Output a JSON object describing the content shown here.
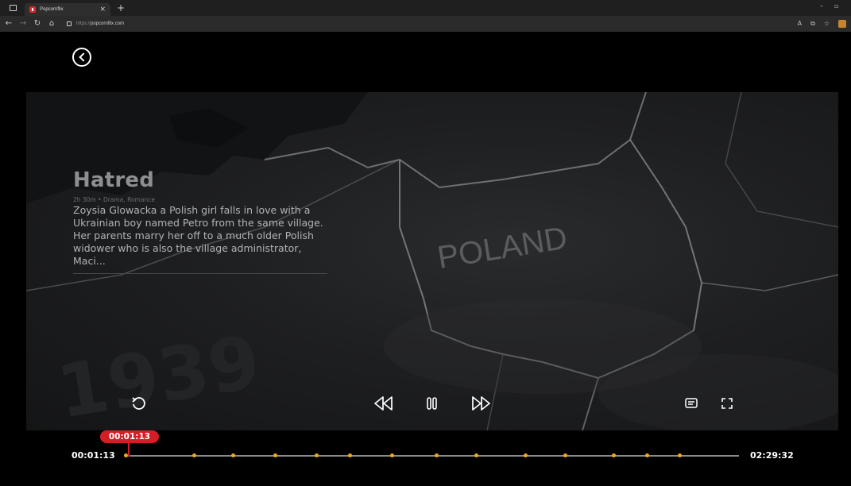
{
  "browser": {
    "tab_title": "Popcornflix",
    "tab_close": "×",
    "new_tab": "+",
    "url_scheme": "https://",
    "url_host": "popcornflix.com",
    "nav": {
      "back": "←",
      "forward": "→",
      "refresh": "↻",
      "home": "⌂"
    },
    "window": {
      "minimize": "–",
      "restore": "▫"
    }
  },
  "movie": {
    "title": "Hatred",
    "meta": "2h 30m • Drama, Romance",
    "description_lines": [
      "Zoysia Glowacka a Polish girl falls in love with a",
      "Ukrainian boy named Petro from the same village.",
      "Her parents marry her off to a much older Polish",
      "widower who is also the village administrator, Maci..."
    ]
  },
  "scene": {
    "map_label": "POLAND",
    "year_label": "1939"
  },
  "player": {
    "current_time": "00:01:13",
    "total_time": "02:29:32",
    "tooltip_time": "00:01:13",
    "progress_fraction": 0.008,
    "chapter_markers": [
      0.0,
      0.112,
      0.175,
      0.244,
      0.311,
      0.365,
      0.434,
      0.506,
      0.571,
      0.651,
      0.716,
      0.795,
      0.85,
      0.903
    ],
    "colors": {
      "accent": "#d21f26",
      "marker": "#f2a81d",
      "track": "#8a8a8a"
    }
  }
}
